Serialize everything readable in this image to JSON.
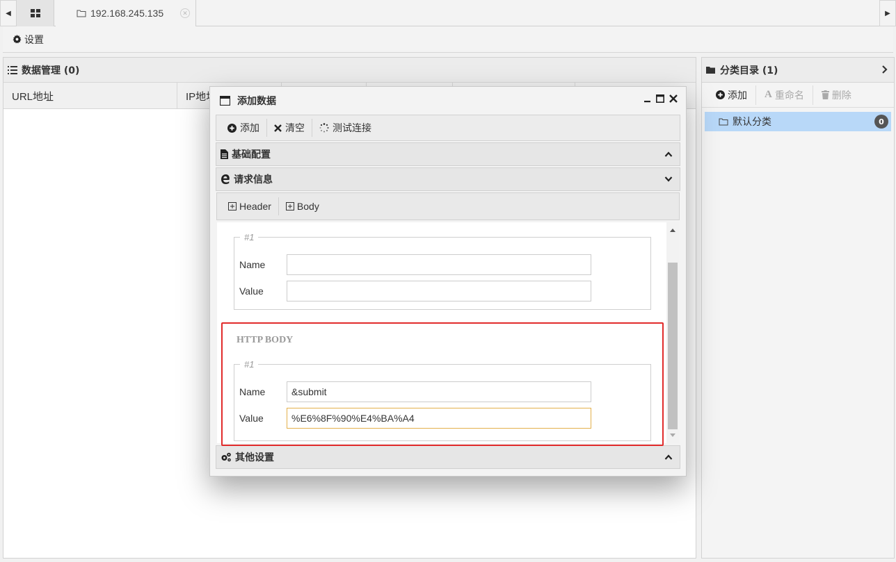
{
  "tabbar": {
    "tab_label": "192.168.245.135"
  },
  "toolbar": {
    "settings_label": "设置"
  },
  "data_panel": {
    "title": "数据管理 (0)",
    "columns": [
      "URL地址",
      "IP地址"
    ]
  },
  "category_panel": {
    "title": "分类目录 (1)",
    "buttons": {
      "add": "添加",
      "rename": "重命名",
      "delete": "删除"
    },
    "items": [
      {
        "label": "默认分类",
        "count": "0"
      }
    ]
  },
  "modal": {
    "title": "添加数据",
    "toolbar": {
      "add": "添加",
      "clear": "清空",
      "test": "测试连接"
    },
    "sections": {
      "basic": "基础配置",
      "request": "请求信息",
      "other": "其他设置"
    },
    "subtabs": {
      "header": "Header",
      "body": "Body"
    },
    "header_fields": {
      "legend": "#1",
      "name_label": "Name",
      "value_label": "Value",
      "name_value": "",
      "value_value": ""
    },
    "body_fields": {
      "section_title": "HTTP BODY",
      "legend": "#1",
      "name_label": "Name",
      "value_label": "Value",
      "name_value": "&submit",
      "value_value": "%E6%8F%90%E4%BA%A4"
    }
  },
  "colors": {
    "highlight_border": "#e12b2b",
    "selected_item_bg": "#b8d8f8",
    "focus_border": "#e3b04b"
  }
}
